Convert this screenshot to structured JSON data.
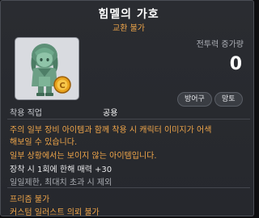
{
  "item": {
    "name": "힘멜의 가호",
    "trade": "교환 불가",
    "job_label": "착용 직업",
    "job_value": "공용",
    "power_label": "전투력 증가량",
    "power_value": "0",
    "tags": [
      "방어구",
      "망토"
    ]
  },
  "description": [
    "주의 일부 장비 아이템과 함께 착용 시 캐릭터 이미지가 어색",
    "해보일 수 있습니다.",
    "일부 상황에서는 보이지 않는 아이템입니다."
  ],
  "effect": "장착 시 1회에 한해 매력 +30",
  "limit": "일일제한, 최대치 초과 시 제외",
  "footer": [
    "프리즘 불가",
    "커스텀 일러스트 의뢰 불가"
  ],
  "colors": {
    "orange": "#f0a64a",
    "background": "#26282d"
  }
}
